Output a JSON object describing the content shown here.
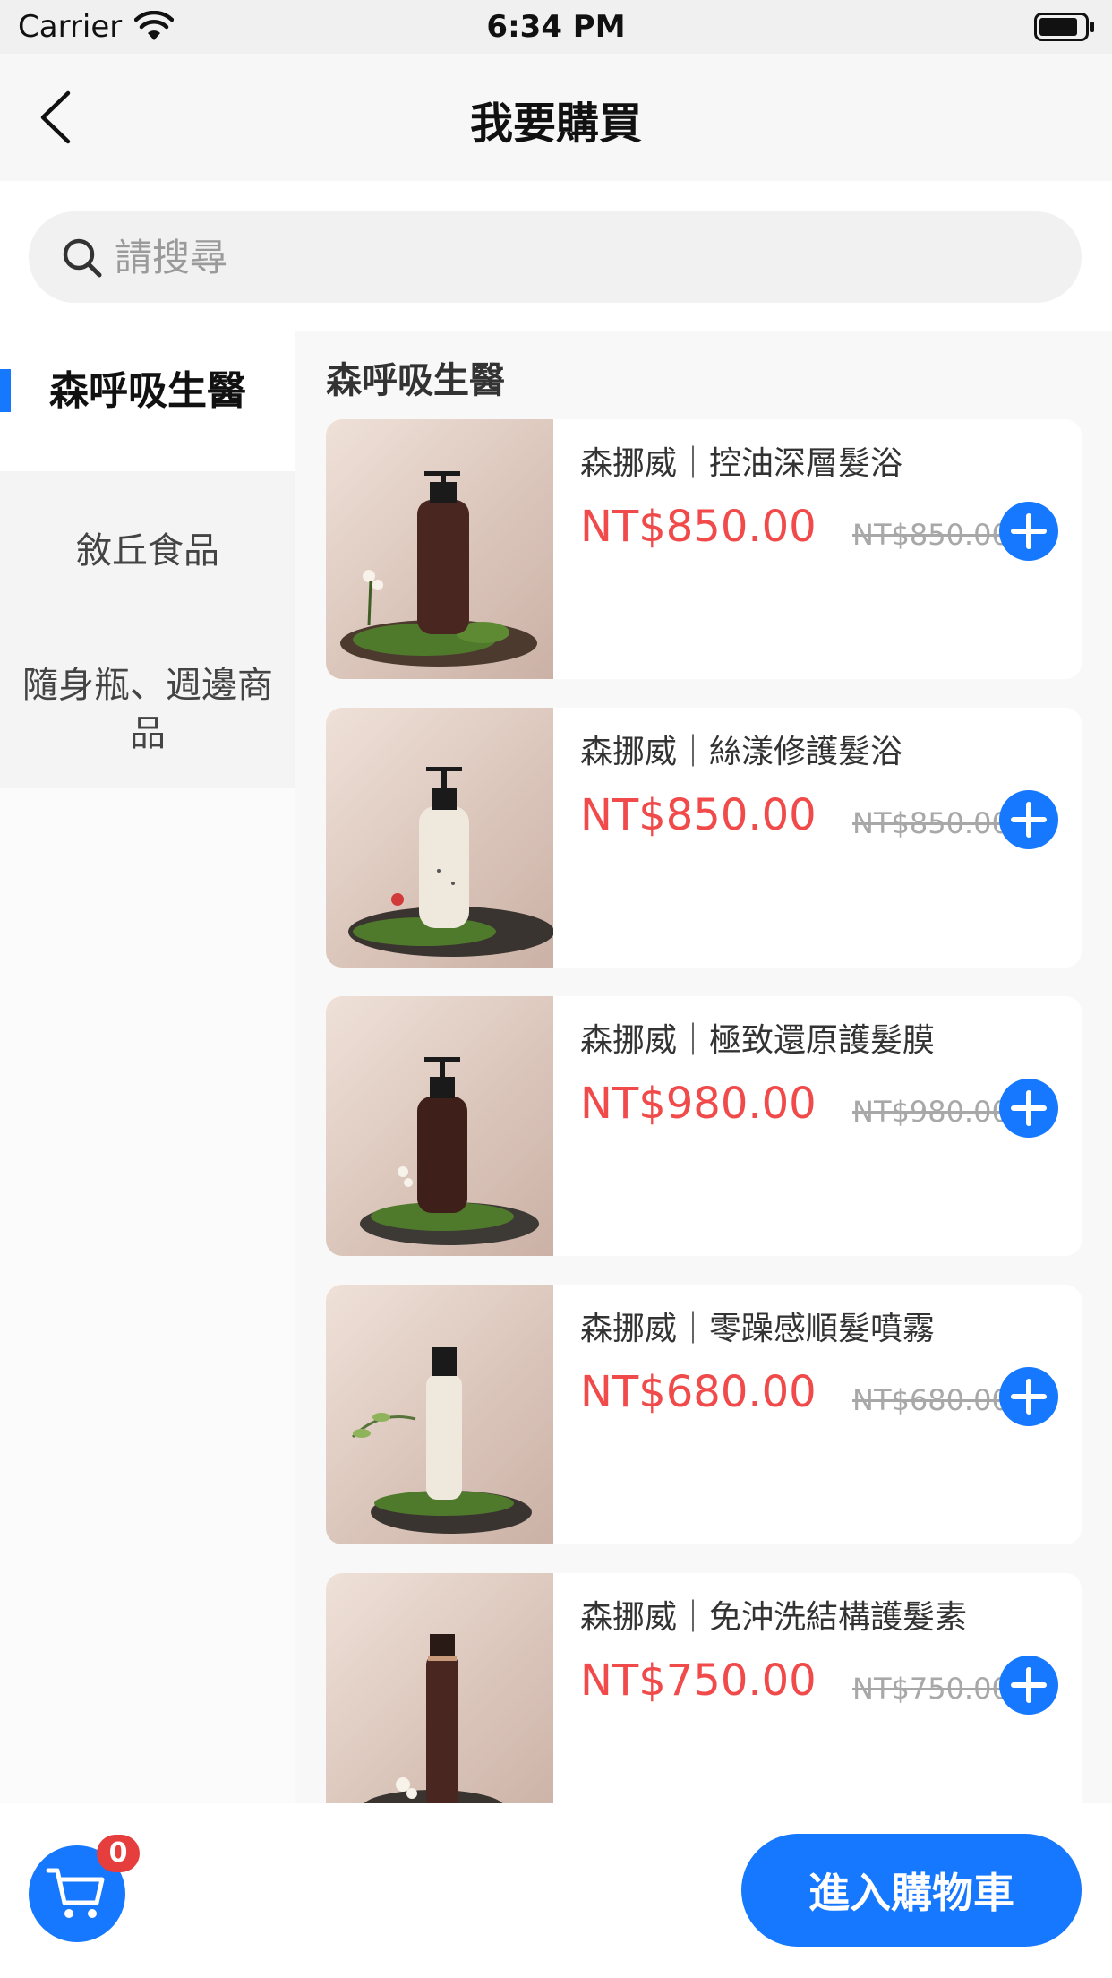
{
  "status_bar": {
    "carrier": "Carrier",
    "time": "6:34 PM"
  },
  "nav": {
    "title": "我要購買"
  },
  "search": {
    "placeholder": "請搜尋",
    "value": ""
  },
  "sidebar": {
    "items": [
      {
        "label": "森呼吸生醫",
        "active": true
      },
      {
        "label": "敘丘食品",
        "active": false
      },
      {
        "label": "隨身瓶、週邊商品",
        "active": false
      }
    ]
  },
  "content": {
    "section_title": "森呼吸生醫",
    "products": [
      {
        "name": "森挪威｜控油深層髮浴",
        "price": "NT$850.00",
        "original_price": "NT$850.00",
        "image": "dark-pump-bottle"
      },
      {
        "name": "森挪威｜絲漾修護髮浴",
        "price": "NT$850.00",
        "original_price": "NT$850.00",
        "image": "white-pump-bottle"
      },
      {
        "name": "森挪威｜極致還原護髮膜",
        "price": "NT$980.00",
        "original_price": "NT$980.00",
        "image": "dark-pump-bottle"
      },
      {
        "name": "森挪威｜零躁感順髮噴霧",
        "price": "NT$680.00",
        "original_price": "NT$680.00",
        "image": "white-spray-bottle"
      },
      {
        "name": "森挪威｜免沖洗結構護髮素",
        "price": "NT$750.00",
        "original_price": "NT$750.00",
        "image": "dark-spray-bottle"
      }
    ]
  },
  "bottom": {
    "cart_count": "0",
    "checkout_label": "進入購物車"
  },
  "colors": {
    "accent": "#1677ff",
    "price": "#f04a4a",
    "badge": "#e63d3d"
  }
}
